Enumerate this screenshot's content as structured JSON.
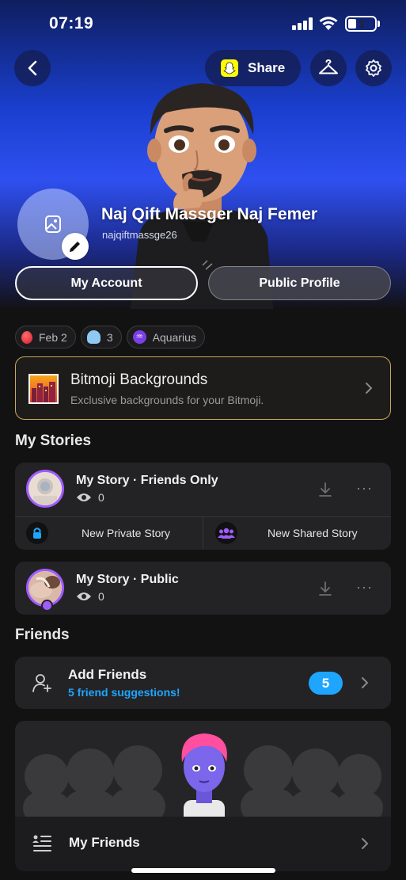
{
  "status_bar": {
    "time": "07:19",
    "battery": "1"
  },
  "header": {
    "share_label": "Share"
  },
  "profile": {
    "display_name": "Naj Qift Massger Naj Femer",
    "username": "najqiftmassge26"
  },
  "buttons": {
    "my_account": "My Account",
    "public_profile": "Public Profile"
  },
  "chips": [
    {
      "label": "Feb 2",
      "icon": "balloon-icon"
    },
    {
      "label": "3",
      "icon": "ghost-icon"
    },
    {
      "label": "Aquarius",
      "icon": "aquarius-icon"
    }
  ],
  "bitmoji_backgrounds": {
    "title": "Bitmoji Backgrounds",
    "subtitle": "Exclusive backgrounds for your Bitmoji."
  },
  "my_stories": {
    "section_title": "My Stories",
    "friends_only": {
      "title": "My Story · Friends Only",
      "views": "0"
    },
    "new_private": "New Private Story",
    "new_shared": "New Shared Story",
    "public": {
      "title": "My Story · Public",
      "views": "0"
    }
  },
  "friends": {
    "section_title": "Friends",
    "add_friends": "Add Friends",
    "suggestions": "5 friend suggestions!",
    "badge_count": "5",
    "my_friends": "My Friends"
  },
  "colors": {
    "accent_blue": "#1ea6ff",
    "story_ring": "#a05cff",
    "gold_border": "#c9a85a",
    "snap_yellow": "#fffc00"
  }
}
